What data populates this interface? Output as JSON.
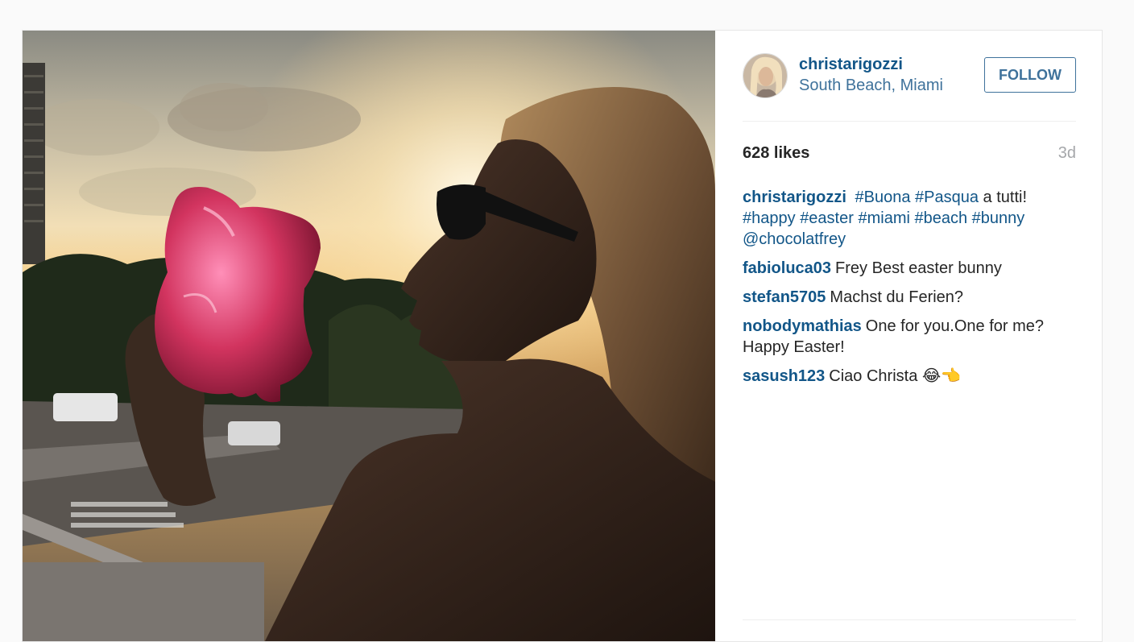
{
  "post": {
    "username": "christarigozzi",
    "location": "South Beach, Miami",
    "follow_label": "FOLLOW",
    "likes": "628 likes",
    "time": "3d",
    "caption": {
      "user": "christarigozzi",
      "tag1": "#Buona",
      "tag2": "#Pasqua",
      "text1": "a tutti!",
      "tag3": "#happy",
      "tag4": "#easter",
      "tag5": "#miami",
      "tag6": "#beach",
      "tag7": "#bunny",
      "mention": "@chocolatfrey"
    },
    "comments": [
      {
        "user": "fabioluca03",
        "text": "Frey Best easter bunny"
      },
      {
        "user": "stefan5705",
        "text": "Machst du Ferien?"
      },
      {
        "user": "nobodymathias",
        "text": "One for you.One for me? Happy Easter!"
      },
      {
        "user": "sasush123",
        "text": "Ciao Christa 😂👈"
      }
    ]
  },
  "colors": {
    "link": "#125688",
    "location": "#3f729b",
    "muted": "#a5a7aa"
  }
}
